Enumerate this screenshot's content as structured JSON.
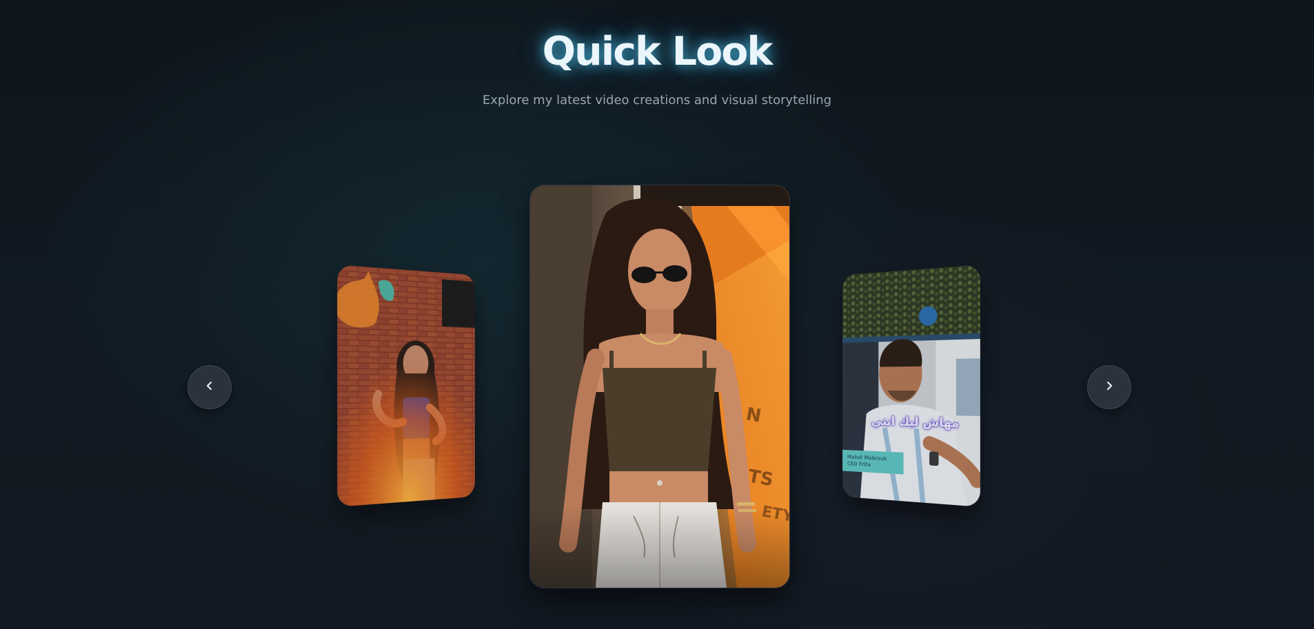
{
  "header": {
    "title": "Quick Look",
    "subtitle": "Explore my latest video creations and visual storytelling"
  },
  "carousel": {
    "prev_icon": "chevron-left-icon",
    "next_icon": "chevron-right-icon",
    "slides": [
      {
        "position": "left",
        "description_icon": "video-thumbnail"
      },
      {
        "position": "center",
        "description_icon": "video-thumbnail"
      },
      {
        "position": "right",
        "description_icon": "video-thumbnail",
        "caption": "مهاش ليك انتي",
        "lower_third_line1": "Mahdi Mabrouk",
        "lower_third_line2": "CEO Frita"
      }
    ]
  },
  "colors": {
    "background": "#0f1720",
    "title_glow": "#50bee6",
    "subtitle": "#9aa6b4",
    "nav_button": "#2a323c"
  }
}
